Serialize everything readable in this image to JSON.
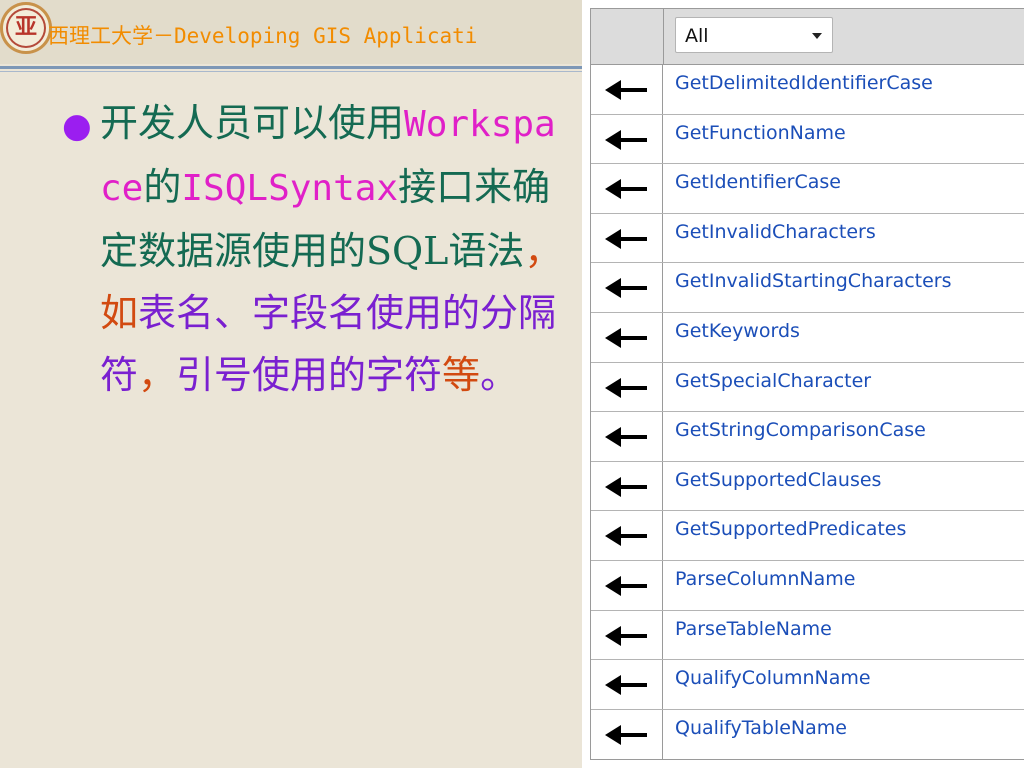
{
  "header": {
    "title_cn": "西理工大学",
    "separator": "－",
    "title_en": "Developing GIS Applicati"
  },
  "slide": {
    "bullet": "●",
    "segments": [
      {
        "text": "开发人员可以使用",
        "style": "teal"
      },
      {
        "text": "Workspace",
        "style": "magenta"
      },
      {
        "text": "的",
        "style": "teal"
      },
      {
        "text": "ISQLSyntax",
        "style": "magenta"
      },
      {
        "text": "接口来确定数据源使用的SQL语法",
        "style": "teal"
      },
      {
        "text": "，",
        "style": "orange"
      },
      {
        "text": "如",
        "style": "orange"
      },
      {
        "text": "表名、字段名使用的分隔符",
        "style": "purple"
      },
      {
        "text": "，",
        "style": "orange"
      },
      {
        "text": "引号使用的字符",
        "style": "purple"
      },
      {
        "text": "等",
        "style": "orange"
      },
      {
        "text": "。",
        "style": "purple"
      }
    ]
  },
  "table": {
    "filter": {
      "selected": "All"
    },
    "rows": [
      {
        "icon": "left-arrow-icon",
        "name": "GetDelimitedIdentifierCase"
      },
      {
        "icon": "left-arrow-icon",
        "name": "GetFunctionName"
      },
      {
        "icon": "left-arrow-icon",
        "name": "GetIdentifierCase"
      },
      {
        "icon": "left-arrow-icon",
        "name": "GetInvalidCharacters"
      },
      {
        "icon": "left-arrow-icon",
        "name": "GetInvalidStartingCharacters"
      },
      {
        "icon": "left-arrow-icon",
        "name": "GetKeywords"
      },
      {
        "icon": "left-arrow-icon",
        "name": "GetSpecialCharacter"
      },
      {
        "icon": "left-arrow-icon",
        "name": "GetStringComparisonCase"
      },
      {
        "icon": "left-arrow-icon",
        "name": "GetSupportedClauses"
      },
      {
        "icon": "left-arrow-icon",
        "name": "GetSupportedPredicates"
      },
      {
        "icon": "left-arrow-icon",
        "name": "ParseColumnName"
      },
      {
        "icon": "left-arrow-icon",
        "name": "ParseTableName"
      },
      {
        "icon": "left-arrow-icon",
        "name": "QualifyColumnName"
      },
      {
        "icon": "left-arrow-icon",
        "name": "QualifyTableName"
      }
    ]
  },
  "colors": {
    "header_text": "#f28c00",
    "teal": "#146a52",
    "magenta": "#e020c8",
    "orange": "#d24a10",
    "purple": "#7a20d0",
    "bullet": "#9b1ef0",
    "link": "#1b4eb8",
    "slide_bg": "#ebe5d7"
  }
}
